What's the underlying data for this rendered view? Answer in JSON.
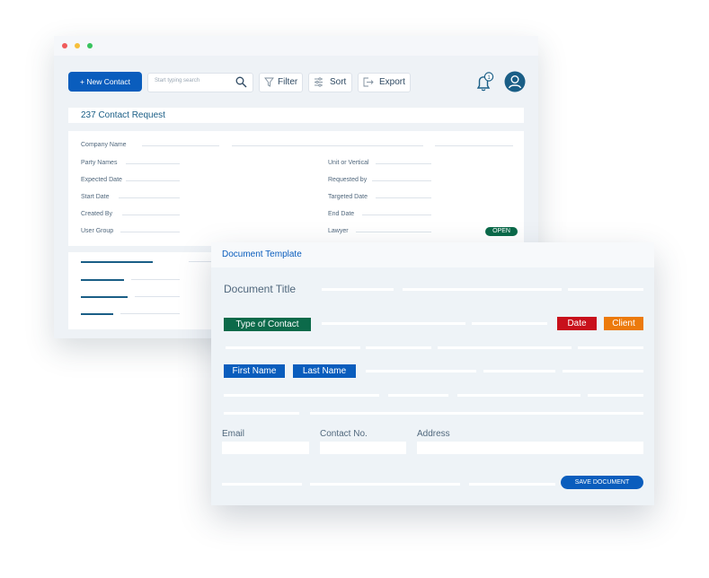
{
  "colors": {
    "primary": "#0a5dbd",
    "open_badge": "#0c6a4a",
    "type_tag": "#0c6a4a",
    "date_tag": "#c8101b",
    "client_tag": "#ec7a0c",
    "name_tag": "#0a5dbd"
  },
  "back_window": {
    "toolbar": {
      "new_contact": "+ New Contact",
      "search_placeholder": "Start typing search",
      "filter": "Filter",
      "sort": "Sort",
      "export": "Export",
      "notification_count": "1"
    },
    "icons": [
      "search-icon",
      "filter-icon",
      "sort-icon",
      "export-icon",
      "bell-icon",
      "user-avatar-icon"
    ],
    "request_title": "237 Contact Request",
    "fields": {
      "company_name": "Company Name",
      "party_names": "Party Names",
      "expected_date": "Expected Date",
      "start_date": "Start Date",
      "created_by": "Created By",
      "user_group": "User Group",
      "unit_or_vertical": "Unit or Vertical",
      "requested_by": "Requested by",
      "targeted_date": "Targeted Date",
      "end_date": "End Date",
      "lawyer": "Lawyer"
    },
    "status": "OPEN"
  },
  "front_window": {
    "header": "Document Template",
    "doc_title": "Document Title",
    "type_of_contact": "Type of Contact",
    "date": "Date",
    "client": "Client",
    "first_name": "First Name",
    "last_name": "Last Name",
    "email": "Email",
    "contact_no": "Contact No.",
    "address": "Address",
    "save_button": "SAVE DOCUMENT"
  }
}
